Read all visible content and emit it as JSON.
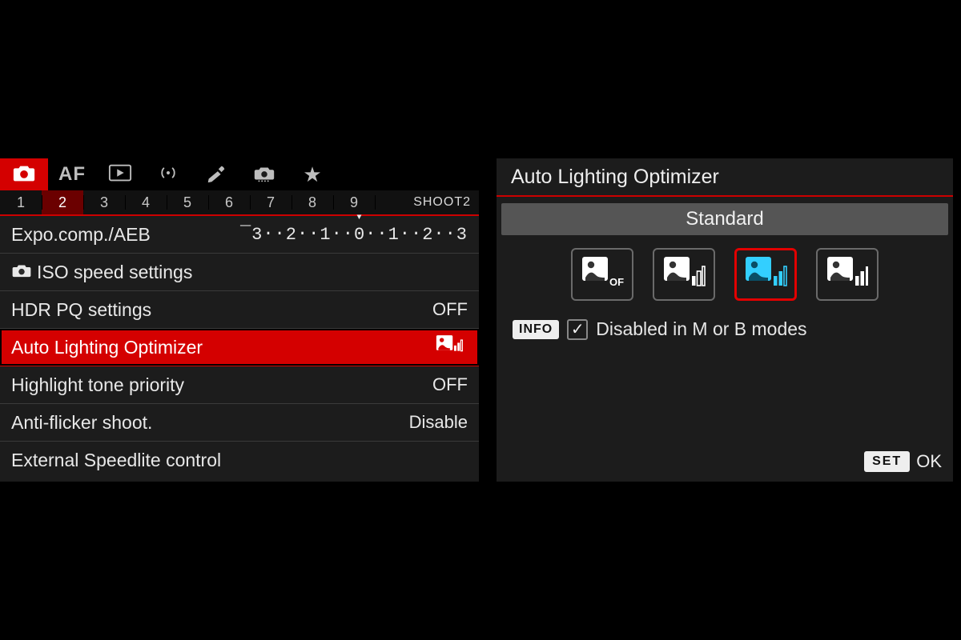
{
  "left": {
    "topTabs": [
      {
        "id": "shoot",
        "selected": true
      },
      {
        "id": "af",
        "label": "AF",
        "selected": false
      },
      {
        "id": "play",
        "selected": false
      },
      {
        "id": "wireless",
        "selected": false
      },
      {
        "id": "wrench",
        "selected": false
      },
      {
        "id": "custom",
        "selected": false
      },
      {
        "id": "star",
        "selected": false
      }
    ],
    "subTabs": {
      "items": [
        "1",
        "2",
        "3",
        "4",
        "5",
        "6",
        "7",
        "8",
        "9"
      ],
      "selectedIndex": 1,
      "pageLabel": "SHOOT2"
    },
    "menu": [
      {
        "label": "Expo.comp./AEB",
        "value": "¯3..2..1..0..1..2..3",
        "type": "scale"
      },
      {
        "label": "ISO speed settings",
        "icon": "camera"
      },
      {
        "label": "HDR PQ settings",
        "value": "OFF"
      },
      {
        "label": "Auto Lighting Optimizer",
        "valueIcon": "alo-standard",
        "selected": true
      },
      {
        "label": "Highlight tone priority",
        "value": "OFF"
      },
      {
        "label": "Anti-flicker shoot.",
        "value": "Disable",
        "valueOffset": true
      },
      {
        "label": "External Speedlite control"
      }
    ]
  },
  "right": {
    "title": "Auto Lighting Optimizer",
    "selectedLabel": "Standard",
    "options": [
      {
        "id": "off",
        "selected": false
      },
      {
        "id": "low",
        "selected": false
      },
      {
        "id": "standard",
        "selected": true
      },
      {
        "id": "high",
        "selected": false
      }
    ],
    "infoButton": "INFO",
    "checkbox": {
      "checked": true,
      "label": "Disabled in M or B modes"
    },
    "setButton": "SET",
    "okLabel": "OK"
  }
}
